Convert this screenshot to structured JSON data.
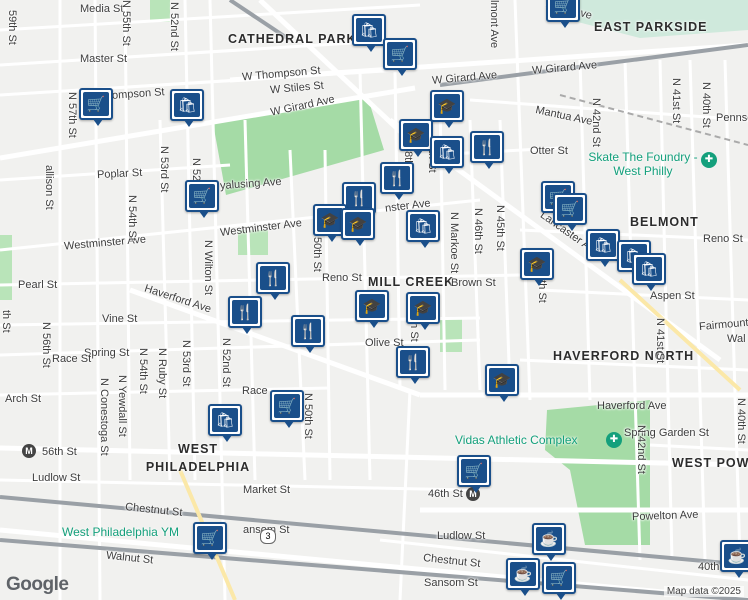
{
  "map": {
    "copyright": "Map data ©2025",
    "logo": "Google",
    "areas": {
      "cathedral_park": "CATHEDRAL PARK",
      "east_parkside": "EAST PARKSIDE",
      "belmont": "BELMONT",
      "mill_creek": "MILL CREEK",
      "haverford_north": "HAVERFORD NORTH",
      "west_philadelphia": "WEST PHILADELPHIA",
      "west_powelton": "WEST POW"
    },
    "pois": {
      "skate": "Skate The Foundry - West Philly",
      "vidas": "Vidas Athletic Complex",
      "ymca": "West Philadelphia YM"
    },
    "streets": {
      "media": "Media St",
      "master": "Master St",
      "w_thompson": "W Thompson St",
      "w_stiles": "W Stiles St",
      "w_girard_1": "W Girard Ave",
      "w_girard_2": "W Girard Ave",
      "w_girard_3": "W Girard Ave",
      "ompson": "ompson St",
      "poplar": "Poplar St",
      "wyalusing": "yalusing Ave",
      "westminster_1": "Westminster Ave",
      "westminster_2": "Westminster Ave",
      "westminster_3": "nster Ave",
      "pearl": "Pearl St",
      "reno_1": "Reno St",
      "reno_2": "Reno St",
      "haverford_1": "Haverford Ave",
      "haverford_2": "Haverford Ave",
      "vine": "Vine St",
      "spring": "Spring St",
      "race_1": "Race St",
      "race_2": "Race",
      "arch": "Arch St",
      "olive": "Olive St",
      "brown": "Brown St",
      "mantua": "Mantua Ave",
      "otter": "Otter St",
      "lancaster": "Lancaster Ave",
      "aspen": "Aspen St",
      "fairmount": "Fairmount Ave",
      "spring_garden": "Spring Garden St",
      "powelton": "Powelton Ave",
      "market": "Market St",
      "ludlow_1": "Ludlow St",
      "ludlow_2": "Ludlow St",
      "chestnut_1": "Chestnut St",
      "chestnut_2": "Chestnut St",
      "walnut": "Walnut St",
      "sansom_1": "ansom St",
      "sansom_2": "Sansom St",
      "st_46th": "46th St",
      "st_56th": "56th St",
      "n_52nd": "N 52nd St",
      "n_52nd_2": "N 52nd St",
      "n_53rd": "N 53rd St",
      "n_53rd_2": "N 53rd St",
      "n_54th": "N 54th St",
      "n_54th_2": "N 54th St",
      "n_55th": "N 55th St",
      "n_56th": "N 56th St",
      "n_57th": "N 57th St",
      "n_50th": "N 50th St",
      "n_48th": "N 48th St",
      "n_46th": "N 46th St",
      "n_45th": "N 45th St",
      "n_44th": "44th St",
      "n_42nd": "N 42nd St",
      "n_42nd_2": "N 42nd St",
      "n_41st": "N 41st St",
      "n_41st_2": "N 41st St",
      "n_40th": "N 40th St",
      "n_40th_2": "N 40th St",
      "n_conestoga": "N Conestoga St",
      "n_yewdall": "N Yewdall St",
      "n_ruby": "N Ruby St",
      "n_wilton": "N Wilton St",
      "n_markoe": "N Markoe St",
      "sedgwick": "allison St",
      "elmont": "lmont Ave",
      "leidy": "Leidy Ave",
      "pennsg": "Pennsg",
      "walk": "Wal",
      "st_50th": "50th St",
      "st_40th": "40th",
      "n_49th": "th St",
      "st_48th": "8th St",
      "n_47th": "th St",
      "st_59th": "59th St",
      "st_59th_2": "th St",
      "route_3": "3",
      "st_56th_v": "N 56th St"
    },
    "markers": [
      {
        "kind": "shopping",
        "icon": "🛍"
      },
      {
        "kind": "grocery",
        "icon": "🛒"
      },
      {
        "kind": "school",
        "icon": "🎓"
      },
      {
        "kind": "restaurant",
        "icon": "🍴"
      },
      {
        "kind": "cafe",
        "icon": "☕"
      }
    ]
  }
}
